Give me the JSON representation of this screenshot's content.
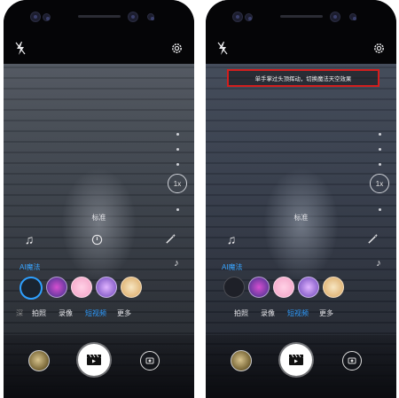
{
  "left": {
    "zoom": "1x",
    "mode_label": "标准",
    "ai_label": "AI魔法",
    "modes": [
      "拍照",
      "录像",
      "短视频",
      "更多"
    ],
    "active_mode": "短视频"
  },
  "right": {
    "zoom": "1x",
    "mode_label": "标准",
    "ai_label": "AI魔法",
    "modes": [
      "拍照",
      "录像",
      "短视频",
      "更多"
    ],
    "active_mode": "短视频",
    "hint": "单手掌过头顶挥动，切换魔法天空效果"
  },
  "colors": {
    "accent": "#2e9cff",
    "highlight_box": "#d21e1e"
  },
  "icons": {
    "flash": "flash-off-icon",
    "settings": "gear-icon",
    "music": "music-note-icon",
    "timer": "timer-icon",
    "beauty": "magic-wand-icon",
    "douyin": "tiktok-icon",
    "shutter": "video-clapper-icon",
    "switch": "camera-switch-icon"
  }
}
